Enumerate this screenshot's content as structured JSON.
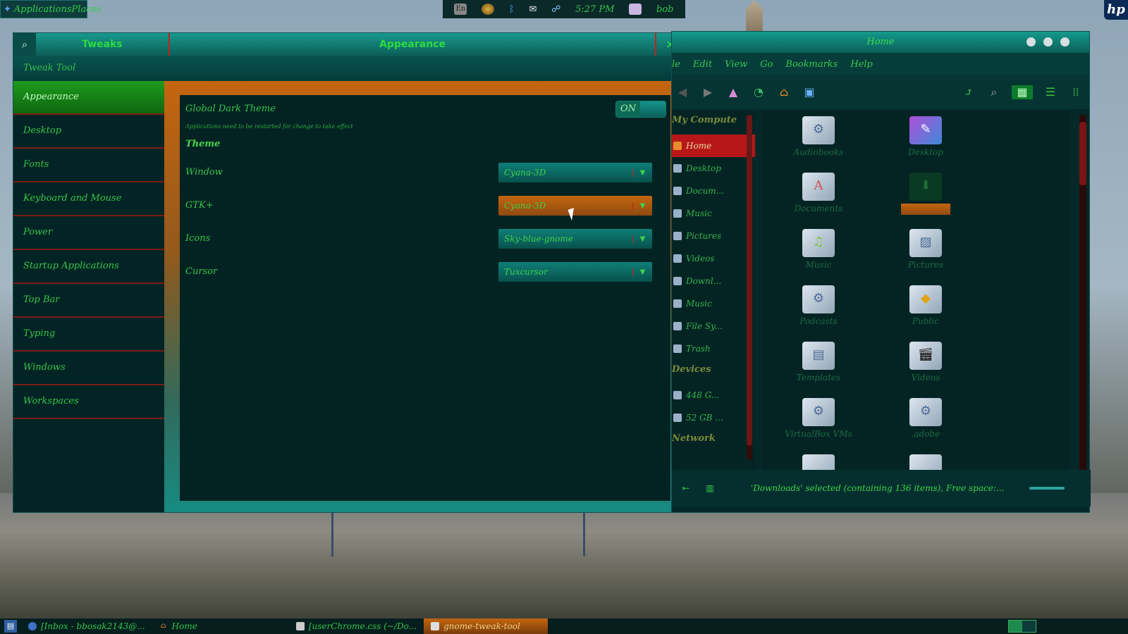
{
  "top_panel": {
    "app_menu_label": "ApplicationsPlaces",
    "tray": {
      "lang": "En",
      "clock": "5:27 PM",
      "user": "bob"
    },
    "hp_logo": "hp"
  },
  "tweak_tool": {
    "header_left": "Tweaks",
    "header_center": "Appearance",
    "close_glyph": "×",
    "subtitle": "Tweak Tool",
    "sidebar": [
      {
        "label": "Appearance",
        "active": true
      },
      {
        "label": "Desktop"
      },
      {
        "label": "Fonts"
      },
      {
        "label": "Keyboard and Mouse"
      },
      {
        "label": "Power"
      },
      {
        "label": "Startup Applications"
      },
      {
        "label": "Top Bar"
      },
      {
        "label": "Typing"
      },
      {
        "label": "Windows"
      },
      {
        "label": "Workspaces"
      }
    ],
    "global_dark": {
      "label": "Global Dark Theme",
      "hint": "Applications need to be restarted for change to take effect",
      "toggle": "ON"
    },
    "theme_section": "Theme",
    "theme_rows": [
      {
        "label": "Window",
        "value": "Cyana-3D"
      },
      {
        "label": "GTK+",
        "value": "Cyana-3D"
      },
      {
        "label": "Icons",
        "value": "Sky-blue-gnome"
      },
      {
        "label": "Cursor",
        "value": "Tuxcursor"
      }
    ]
  },
  "file_manager": {
    "title": "Home",
    "menu": [
      "le",
      "Edit",
      "View",
      "Go",
      "Bookmarks",
      "Help"
    ],
    "sidebar_headers": {
      "places": "My Compute",
      "devices": "Devices",
      "network": "Network"
    },
    "places": [
      "Home",
      "Desktop",
      "Docum...",
      "Music",
      "Pictures",
      "Videos",
      "Downl...",
      "Music",
      "File Sy...",
      "Trash"
    ],
    "devices": [
      "448 G...",
      "52 GB ..."
    ],
    "icons": [
      {
        "name": "Audiobooks"
      },
      {
        "name": "Desktop"
      },
      {
        "name": "Documents"
      },
      {
        "name": ""
      },
      {
        "name": "Music"
      },
      {
        "name": "Pictures"
      },
      {
        "name": "Podcasts"
      },
      {
        "name": "Public"
      },
      {
        "name": "Templates"
      },
      {
        "name": "Videos"
      },
      {
        "name": "VirtualBox VMs"
      },
      {
        "name": ".adobe"
      }
    ],
    "status": "'Downloads' selected (containing 136 items), Free space:..."
  },
  "taskbar": {
    "tasks": [
      {
        "label": "[Inbox - bbosak2143@..."
      },
      {
        "label": "Home"
      },
      {
        "label": "[userChrome.css (~/Do..."
      },
      {
        "label": "gnome-tweak-tool"
      }
    ]
  },
  "colors": {
    "accent_green": "#2bdc3f",
    "window_bg": "#032727",
    "active_orange": "#c4650f",
    "selection_red": "#b8171a"
  }
}
